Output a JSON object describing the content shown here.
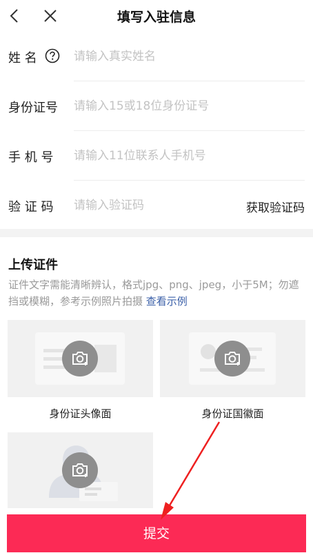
{
  "header": {
    "title": "填写入驻信息",
    "back_icon": "chevron-left-icon",
    "close_icon": "close-icon"
  },
  "form": {
    "name": {
      "label": "姓 名",
      "placeholder": "请输入真实姓名",
      "help_icon": "question-circle-icon"
    },
    "id_number": {
      "label": "身份证号",
      "placeholder": "请输入15或18位身份证号"
    },
    "phone": {
      "label": "手 机 号",
      "placeholder": "请输入11位联系人手机号"
    },
    "code": {
      "label": "验 证 码",
      "placeholder": "请输入验证码",
      "get_code": "获取验证码"
    }
  },
  "upload": {
    "title": "上传证件",
    "desc": "证件文字需能清晰辨认，格式jpg、png、jpeg，小于5M；勿遮挡或模糊，参考示例照片拍摄",
    "example_link": "查看示例",
    "cards": [
      {
        "caption": "身份证头像面",
        "icon": "camera-icon"
      },
      {
        "caption": "身份证国徽面",
        "icon": "camera-icon"
      },
      {
        "caption": "",
        "icon": "camera-icon"
      }
    ]
  },
  "submit_label": "提交",
  "colors": {
    "accent": "#fc2a55",
    "link": "#3a5fa8",
    "placeholder": "#c3c3c3",
    "annotation": "#ee2020"
  }
}
